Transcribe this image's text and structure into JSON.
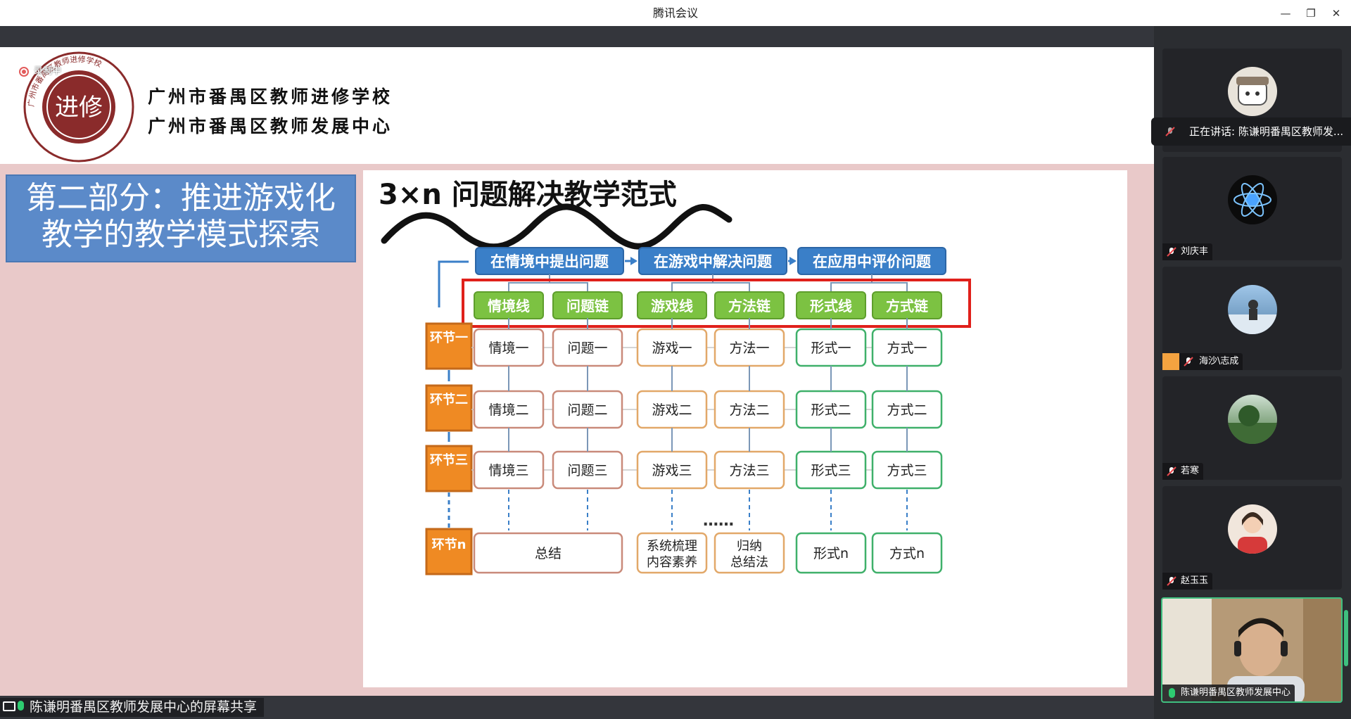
{
  "window": {
    "title": "腾讯会议",
    "minimize_glyph": "—",
    "maximize_glyph": "❐",
    "close_glyph": "✕"
  },
  "slide": {
    "recording_label": "录制中",
    "school_name_1": "广州市番禺区教师进修学校",
    "school_name_2": "广州市番禺区教师发展中心",
    "seal_text": "广州市番禺区教师进修学校",
    "seal_center": "进修",
    "section_title_line1": "第二部分：推进游戏化",
    "section_title_line2": "教学的教学模式探索",
    "panel_title": "3×n 问题解决教学范式",
    "diagram": {
      "top_stages": [
        "在情境中提出问题",
        "在游戏中解决问题",
        "在应用中评价问题"
      ],
      "chains": [
        "情境线",
        "问题链",
        "游戏线",
        "方法链",
        "形式线",
        "方式链"
      ],
      "steps": [
        {
          "label": "环节一",
          "cells": [
            "情境一",
            "问题一",
            "游戏一",
            "方法一",
            "形式一",
            "方式一"
          ]
        },
        {
          "label": "环节二",
          "cells": [
            "情境二",
            "问题二",
            "游戏二",
            "方法二",
            "形式二",
            "方式二"
          ]
        },
        {
          "label": "环节三",
          "cells": [
            "情境三",
            "问题三",
            "游戏三",
            "方法三",
            "形式三",
            "方式三"
          ]
        }
      ],
      "ellipsis": "……",
      "final_step": {
        "label": "环节n",
        "summary": "总结",
        "game_final_line1": "系统梳理",
        "game_final_line2": "内容素养",
        "method_final_line1": "归纳",
        "method_final_line2": "总结法",
        "form_final": "形式n",
        "mode_final": "方式n"
      }
    }
  },
  "bottom": {
    "share_status": "陈谦明番禺区教师发展中心的屏幕共享"
  },
  "participants": {
    "speaking_banner": "正在讲话: 陈谦明番禺区教师发...",
    "tiles": [
      {
        "name": "刘庆丰"
      },
      {
        "name": "海沙\\志成"
      },
      {
        "name": "若寒"
      },
      {
        "name": "赵玉玉"
      }
    ],
    "self_name": "陈谦明番禺区教师发展中心"
  },
  "colors": {
    "accent_green": "#3fbf7f",
    "stage_blue": "#3a7fc8",
    "chain_green": "#7cc242",
    "step_orange": "#ef8a23",
    "highlight_red": "#e0201b"
  }
}
